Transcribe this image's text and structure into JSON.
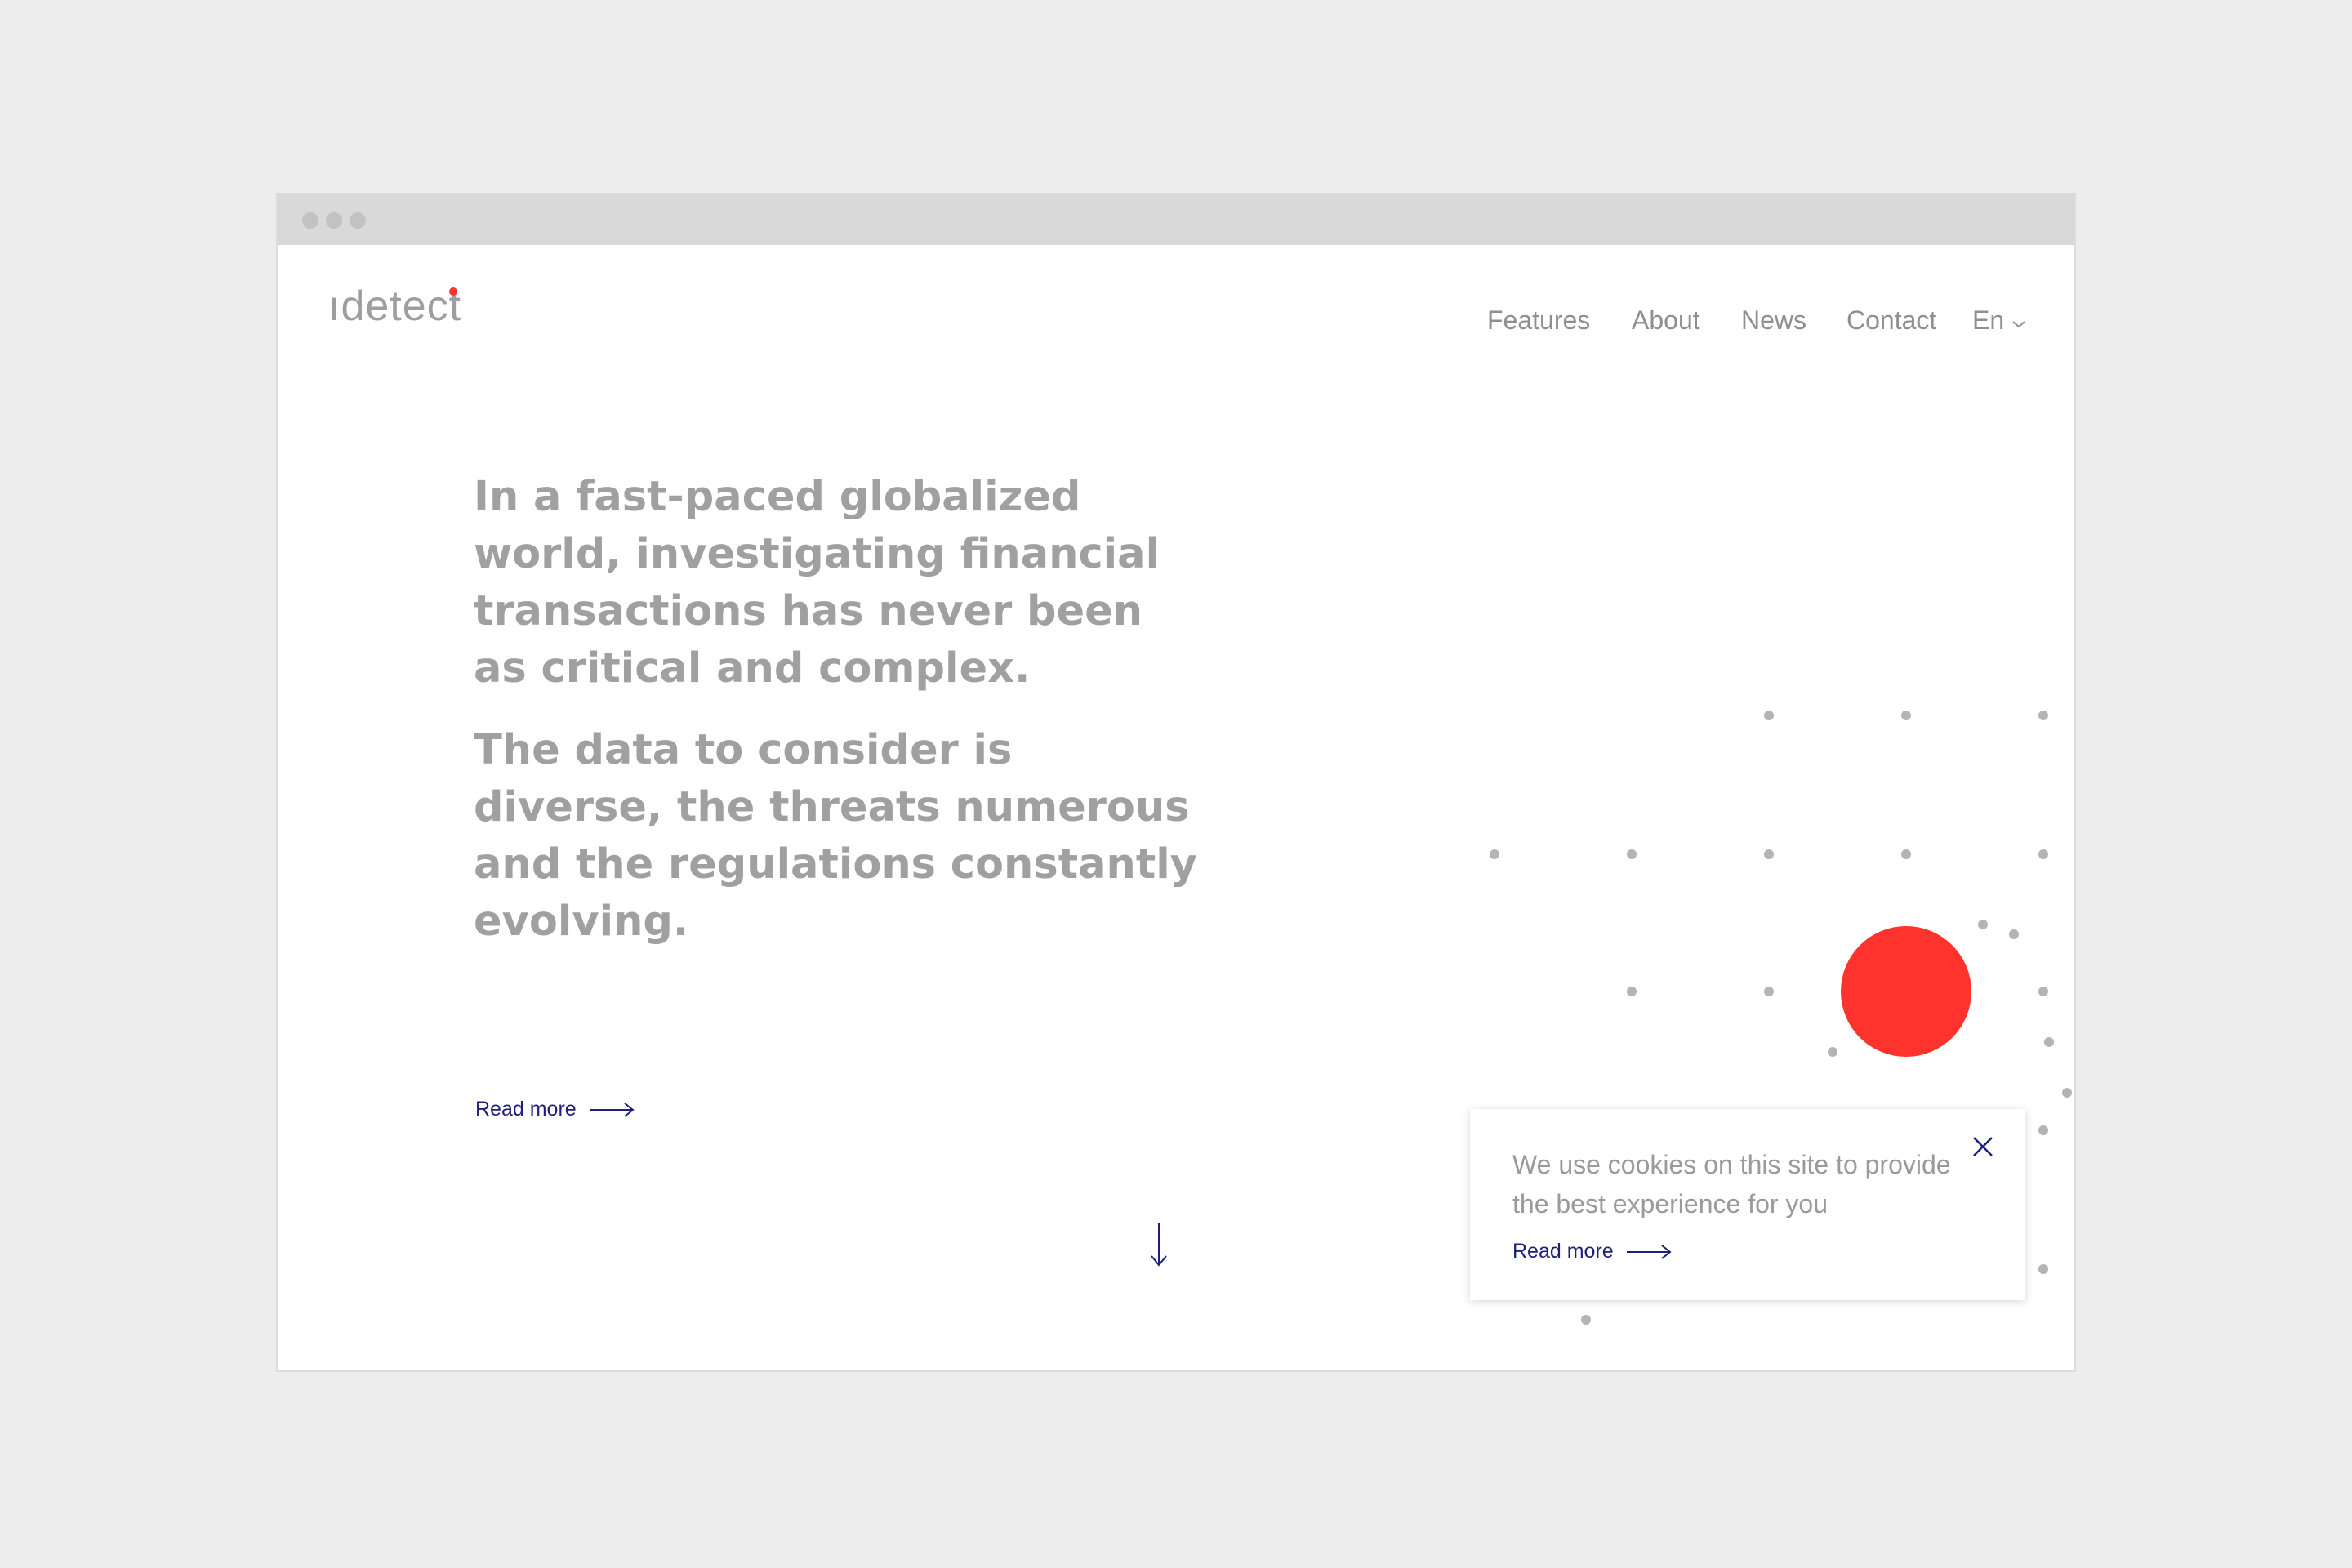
{
  "header": {
    "logo_text": "ıdetect",
    "nav": [
      {
        "label": "Features"
      },
      {
        "label": "About"
      },
      {
        "label": "News"
      },
      {
        "label": "Contact"
      }
    ],
    "language": "En"
  },
  "hero": {
    "paragraph1": "In a fast-paced globalized world, investigating financial transactions has never been as critical and complex.",
    "paragraph2": "The data to consider is diverse, the threats numerous and the regulations constantly evolving.",
    "read_more": "Read more"
  },
  "cookie_banner": {
    "text": "We use cookies on this site to provide the best experience for you",
    "read_more": "Read more"
  },
  "colors": {
    "accent": "#ff332d",
    "link": "#1d1f7a",
    "text_gray": "#a0a0a0",
    "dot_gray": "#b4b4b4"
  },
  "icons": {
    "close": "close-icon",
    "arrow_right": "arrow-right-icon",
    "arrow_down": "arrow-down-icon",
    "chevron": "chevron-down-icon"
  }
}
